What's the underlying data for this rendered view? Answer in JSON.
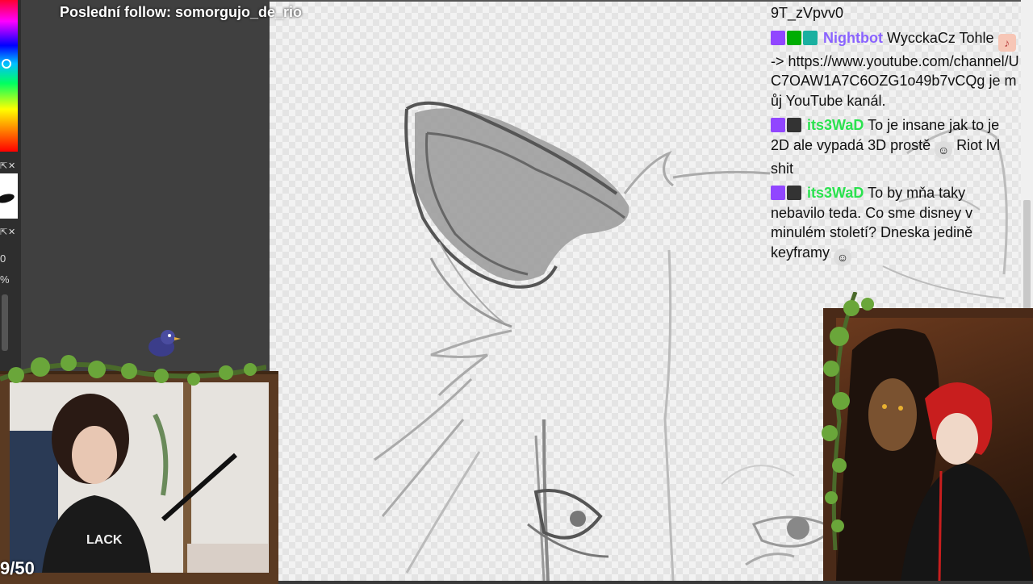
{
  "stream": {
    "last_follow_label": "Poslední follow: somorgujo_de_rio",
    "counter": "9/50"
  },
  "left_panel": {
    "mini_value_1": "0",
    "mini_value_2": "%"
  },
  "chat": {
    "messages": [
      {
        "user": "",
        "text": "9T_zVpvv0"
      },
      {
        "user": "Nightbot",
        "text_1": "WycckaCz Tohle",
        "text_2": "-> https://www.youtube.com/channel/UC7OAW1A7C6OZG1o49b7vCQg je můj YouTube kanál."
      },
      {
        "user": "its3WaD",
        "text": "To je insane jak to je 2D ale vypadá 3D prostě",
        "text_2": "Riot lvl shit"
      },
      {
        "user": "its3WaD",
        "text": "To by mňa taky nebavilo teda. Co sme disney v minulém století? Dneska jedině keyframy"
      }
    ]
  },
  "colors": {
    "nightbot": "#8a63ff",
    "its3wad": "#2be24f",
    "twitch_badge": "#9146ff"
  }
}
